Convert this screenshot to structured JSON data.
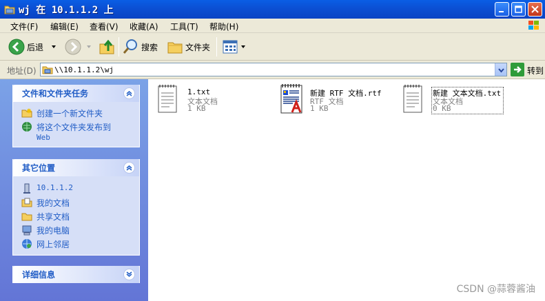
{
  "window": {
    "title": "wj 在 10.1.1.2 上"
  },
  "menu": {
    "items": [
      "文件(F)",
      "编辑(E)",
      "查看(V)",
      "收藏(A)",
      "工具(T)",
      "帮助(H)"
    ]
  },
  "toolbar": {
    "back_label": "后退",
    "search_label": "搜索",
    "folders_label": "文件夹"
  },
  "address": {
    "label": "地址(D)",
    "value": "\\\\10.1.1.2\\wj",
    "go_label": "转到"
  },
  "tasks_panel": {
    "title": "文件和文件夹任务",
    "links": [
      "创建一个新文件夹",
      "将这个文件夹发布到",
      "Web"
    ]
  },
  "places_panel": {
    "title": "其它位置",
    "links": [
      "10.1.1.2",
      "我的文档",
      "共享文档",
      "我的电脑",
      "网上邻居"
    ]
  },
  "details_panel": {
    "title": "详细信息"
  },
  "files": [
    {
      "name": "1.txt",
      "type": "文本文档",
      "size": "1 KB",
      "icon": "text-document-icon"
    },
    {
      "name": "新建 RTF 文档.rtf",
      "type": "RTF 文档",
      "size": "1 KB",
      "icon": "rtf-document-icon"
    },
    {
      "name": "新建 文本文档.txt",
      "type": "文本文档",
      "size": "0 KB",
      "icon": "text-document-icon"
    }
  ],
  "watermark": "CSDN @蒜蓉酱油"
}
